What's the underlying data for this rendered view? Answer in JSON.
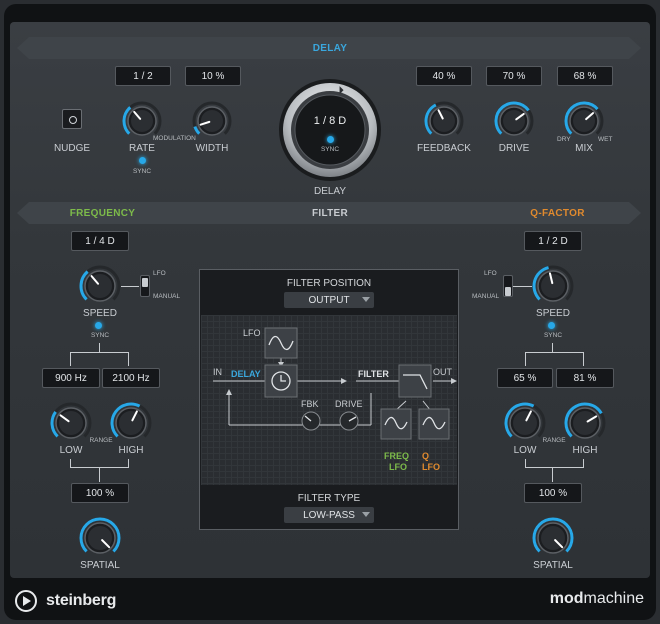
{
  "delay": {
    "title": "DELAY",
    "rate_value": "1 / 2",
    "width_value": "10 %",
    "feedback_value": "40 %",
    "drive_value": "70 %",
    "mix_value": "68 %",
    "nudge_label": "NUDGE",
    "rate_label": "RATE",
    "sync_label": "SYNC",
    "modulation_label": "MODULATION",
    "width_label": "WIDTH",
    "main_value": "1 / 8 D",
    "main_sync": "SYNC",
    "main_label": "DELAY",
    "feedback_label": "FEEDBACK",
    "drive_label": "DRIVE",
    "mix_label": "MIX",
    "dry_label": "DRY",
    "wet_label": "WET"
  },
  "filter": {
    "title": "FILTER",
    "frequency_title": "FREQUENCY",
    "qfactor_title": "Q-FACTOR",
    "freq_speed_value": "1 / 4 D",
    "q_speed_value": "1 / 2 D",
    "lfo_label": "LFO",
    "manual_label": "MANUAL",
    "speed_label": "SPEED",
    "sync_label": "SYNC",
    "freq_low_value": "900 Hz",
    "freq_high_value": "2100 Hz",
    "q_low_value": "65 %",
    "q_high_value": "81 %",
    "range_label": "RANGE",
    "low_label": "LOW",
    "high_label": "HIGH",
    "freq_spatial_value": "100 %",
    "q_spatial_value": "100 %",
    "spatial_label": "SPATIAL",
    "position_label": "FILTER POSITION",
    "position_value": "OUTPUT",
    "type_label": "FILTER TYPE",
    "type_value": "LOW-PASS",
    "diagram": {
      "lfo": "LFO",
      "in": "IN",
      "delay": "DELAY",
      "filter": "FILTER",
      "out": "OUT",
      "fbk": "FBK",
      "drive": "DRIVE",
      "freq": "FREQ",
      "freq_lfo": "LFO",
      "q": "Q",
      "q_lfo": "LFO"
    }
  },
  "footer": {
    "brand": "steinberg",
    "product_bold": "mod",
    "product_rest": "machine"
  },
  "colors": {
    "accent_blue": "#27a8e8",
    "delay_title": "#3aa7dd",
    "frequency_title": "#7dbb4a",
    "qfactor_title": "#e08a2e"
  },
  "knobs": {
    "rate": 0.35,
    "width": 0.1,
    "feedback": 0.4,
    "drive": 0.7,
    "mix": 0.68,
    "freq_speed": 0.35,
    "q_speed": 0.45,
    "freq_low": 0.3,
    "freq_high": 0.6,
    "q_low": 0.6,
    "q_high": 0.72,
    "freq_spatial": 1.0,
    "q_spatial": 1.0,
    "main_delay": 0.55
  }
}
